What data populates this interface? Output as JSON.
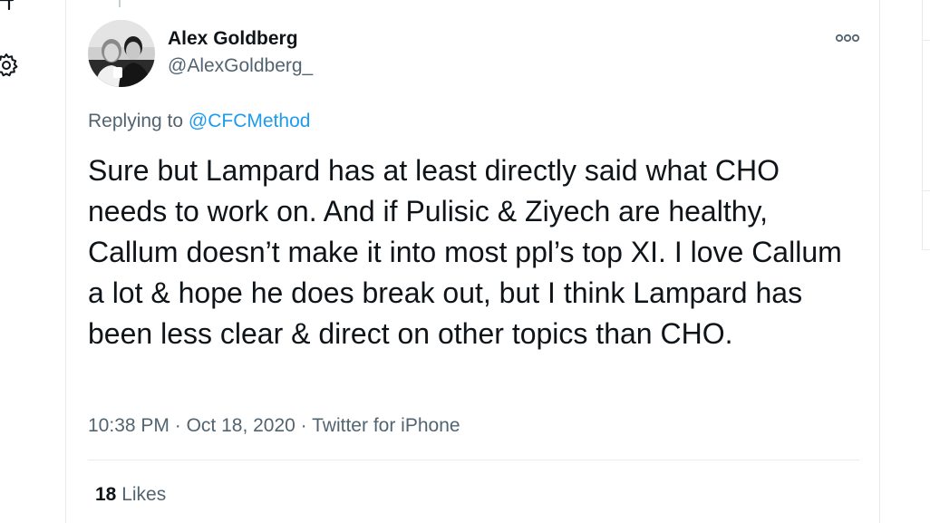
{
  "tweet": {
    "author": {
      "name": "Alex Goldberg",
      "handle": "@AlexGoldberg_"
    },
    "replying_prefix": "Replying to",
    "replying_to": "@CFCMethod",
    "text": "Sure but Lampard has at least directly said what CHO needs to work on. And if Pulisic & Ziyech are healthy, Callum doesn’t make it into most ppl’s top XI. I love Callum a lot & hope he does break out, but I think Lampard has been less clear & direct on other topics than CHO.",
    "time": "10:38 PM",
    "separator": "·",
    "date": "Oct 18, 2020",
    "source": "Twitter for iPhone",
    "likes_count": "18",
    "likes_label": "Likes"
  },
  "icons": {
    "nav_top": "partial-nav-icon",
    "nav_settings": "gear-icon",
    "more": "more-options-icon",
    "avatar": "avatar-photo"
  },
  "colors": {
    "text_primary": "#0f1419",
    "text_secondary": "#536471",
    "link": "#1d9bf0",
    "border": "#e6ecf0"
  }
}
